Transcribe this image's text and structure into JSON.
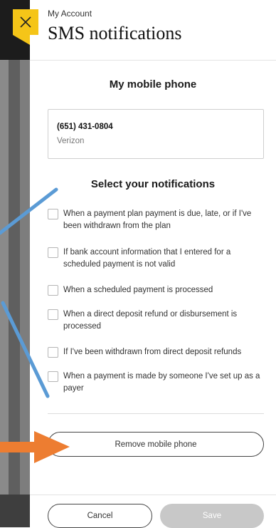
{
  "header": {
    "breadcrumb": "My Account",
    "title": "SMS notifications"
  },
  "phone_section": {
    "title": "My mobile phone",
    "phone_number": "(651) 431-0804",
    "carrier": "Verizon"
  },
  "notifications_section": {
    "title": "Select your notifications",
    "items": [
      {
        "label": "When a payment plan payment is due, late, or if I've been withdrawn from the plan",
        "checked": false
      },
      {
        "label": "If bank account information that I entered for a scheduled payment is not valid",
        "checked": false
      },
      {
        "label": "When a scheduled payment is processed",
        "checked": false
      },
      {
        "label": "When a direct deposit refund or disbursement is processed",
        "checked": false
      },
      {
        "label": "If I've been withdrawn from direct deposit refunds",
        "checked": false
      },
      {
        "label": "When a payment is made by someone I've set up as a payer",
        "checked": false
      }
    ]
  },
  "actions": {
    "remove_phone_label": "Remove mobile phone",
    "cancel_label": "Cancel",
    "save_label": "Save"
  },
  "icons": {
    "close": "close-icon"
  },
  "colors": {
    "accent": "#f5c518",
    "annotation_blue": "#5b9bd5",
    "annotation_orange": "#ed7d31",
    "disabled_button": "#c8c8c8"
  }
}
